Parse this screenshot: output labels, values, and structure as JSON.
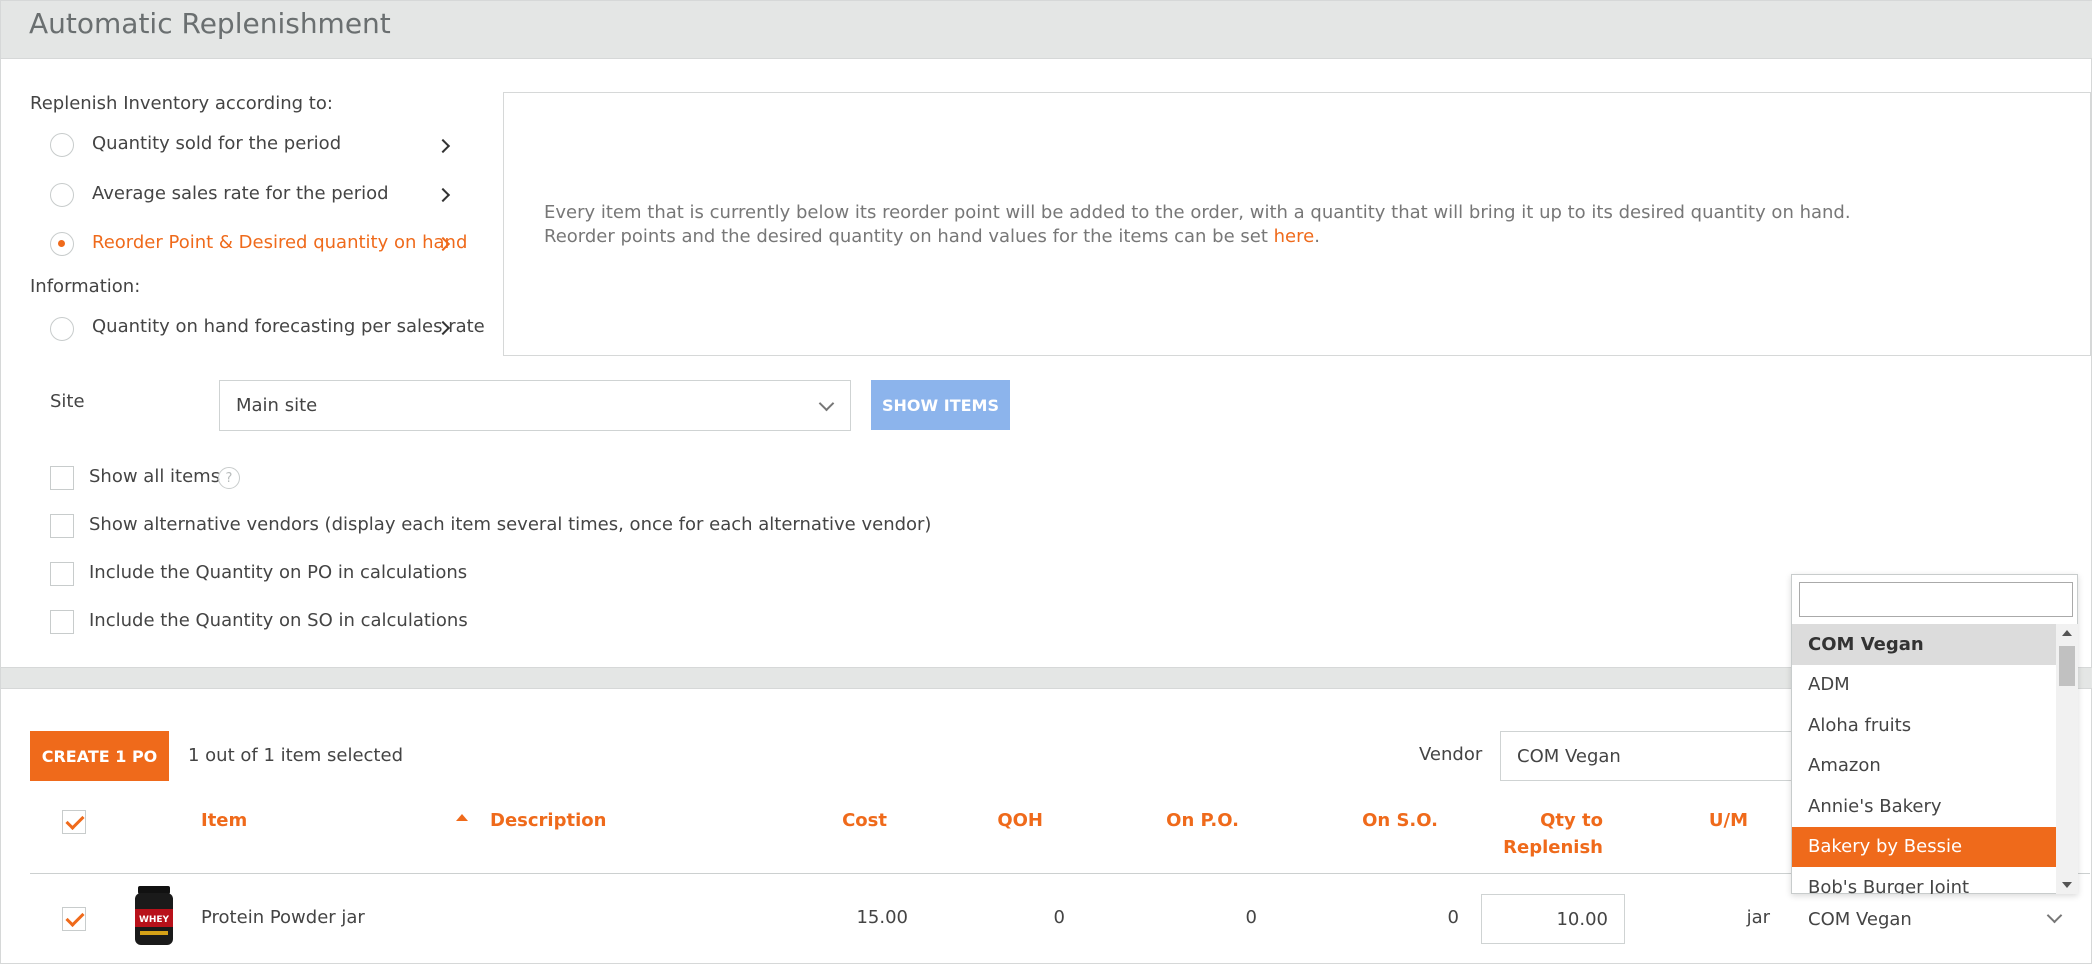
{
  "header": {
    "title": "Automatic Replenishment"
  },
  "replenish": {
    "heading": "Replenish Inventory according to:",
    "options": [
      {
        "label": "Quantity sold for the period",
        "selected": false
      },
      {
        "label": "Average sales rate for the period",
        "selected": false
      },
      {
        "label": "Reorder Point & Desired quantity on hand",
        "selected": true
      }
    ],
    "info_heading": "Information:",
    "info_option": {
      "label": "Quantity on hand forecasting per sales rate",
      "selected": false
    }
  },
  "info_box": {
    "line1": "Every item that is currently below its reorder point will be added to the order, with a quantity that will bring it up to its desired quantity on hand.",
    "line2_prefix": "Reorder points and the desired quantity on hand values for the items can be set ",
    "link_text": "here",
    "line2_suffix": "."
  },
  "site": {
    "label": "Site",
    "value": "Main site",
    "button": "SHOW ITEMS"
  },
  "checkboxes": [
    {
      "label": "Show all items",
      "checked": false
    },
    {
      "label": "Show alternative vendors (display each item several times, once for each alternative vendor)",
      "checked": false
    },
    {
      "label": "Include the Quantity on PO in calculations",
      "checked": false
    },
    {
      "label": "Include the Quantity on SO in calculations",
      "checked": false
    }
  ],
  "actions": {
    "create_button": "CREATE 1 PO",
    "selection_text": "1 out of 1 item selected",
    "vendor_label": "Vendor",
    "vendor_value": "COM Vegan"
  },
  "table": {
    "columns": {
      "item": "Item",
      "description": "Description",
      "cost": "Cost",
      "qoh": "QOH",
      "on_po": "On P.O.",
      "on_so": "On S.O.",
      "qty_line1": "Qty to",
      "qty_line2": "Replenish",
      "um": "U/M"
    },
    "rows": [
      {
        "checked": true,
        "item": "Protein Powder jar",
        "description": "",
        "cost": "15.00",
        "qoh": "0",
        "on_po": "0",
        "on_so": "0",
        "qty": "10.00",
        "um": "jar",
        "vendor": "COM Vegan",
        "image_label": "WHEY"
      }
    ]
  },
  "dropdown": {
    "search_value": "",
    "options": [
      "COM Vegan",
      "ADM",
      "Aloha fruits",
      "Amazon",
      "Annie's Bakery",
      "Bakery by Bessie",
      "Bob's Burger Joint"
    ],
    "selected": "COM Vegan",
    "highlighted": "Bakery by Bessie"
  },
  "colors": {
    "accent": "#ef6a1b",
    "button_disabled": "#8cb4ec",
    "header_bg": "#e4e6e5"
  }
}
